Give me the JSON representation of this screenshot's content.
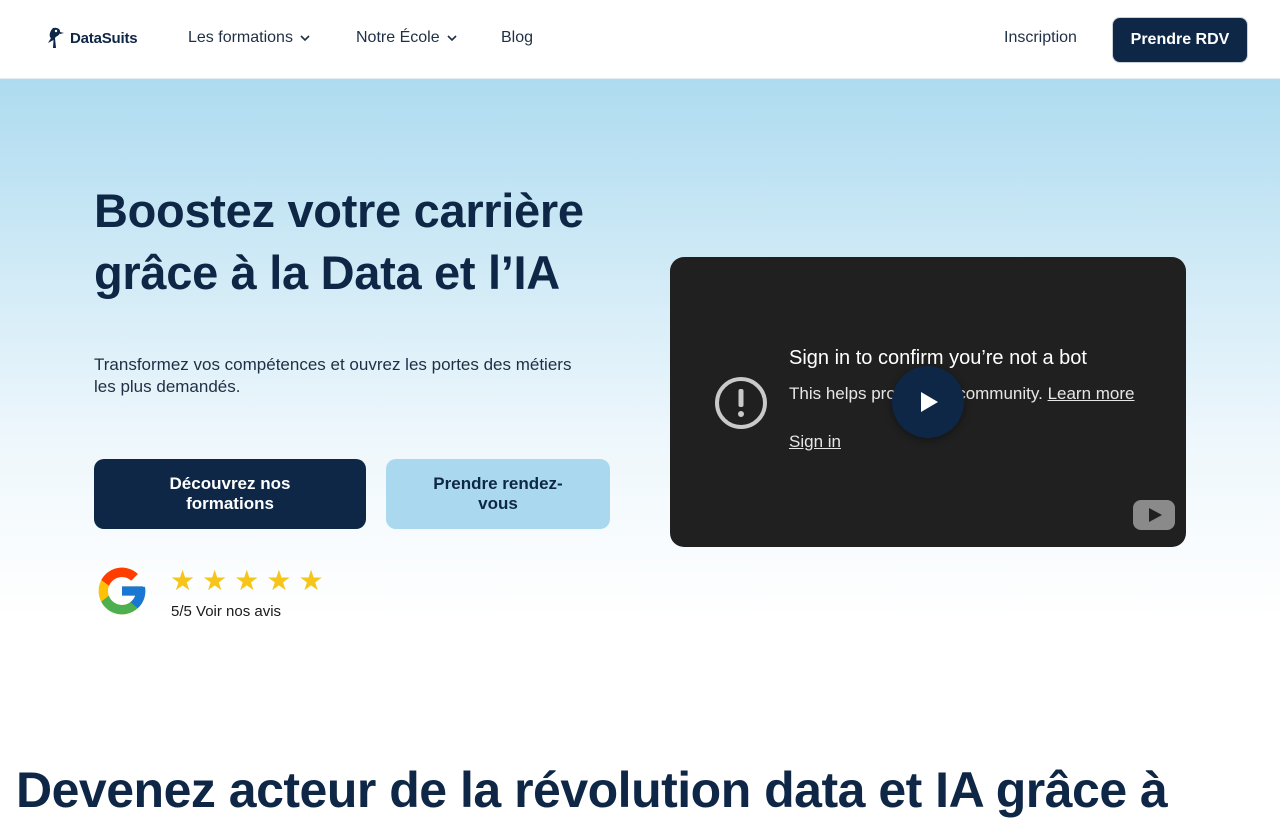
{
  "header": {
    "logo_text": "DataSuits",
    "nav": [
      {
        "label": "Les formations"
      },
      {
        "label": "Notre École"
      },
      {
        "label": "Blog"
      }
    ],
    "inscription_label": "Inscription",
    "cta_label": "Prendre RDV"
  },
  "hero": {
    "title_line1": "Boostez votre carrière",
    "title_line2": "grâce à la Data et l’IA",
    "subtitle": "Transformez vos compétences et ouvrez les portes des métiers les plus demandés.",
    "primary_button": "Découvrez nos formations",
    "secondary_button": "Prendre rendez-vous",
    "rating": {
      "stars": 5,
      "star_glyph": "★",
      "text": "5/5 Voir nos avis"
    }
  },
  "video": {
    "title": "Sign in to confirm you’re not a bot",
    "body_prefix": "This helps protect our community. ",
    "learn_more": "Learn more",
    "sign_in": "Sign in"
  },
  "section": {
    "heading": "Devenez acteur de la révolution data et IA grâce à"
  },
  "colors": {
    "brand_navy": "#0f2747",
    "light_blue": "#a9d8ef",
    "star_yellow": "#f6c51a",
    "video_bg": "#202020"
  }
}
